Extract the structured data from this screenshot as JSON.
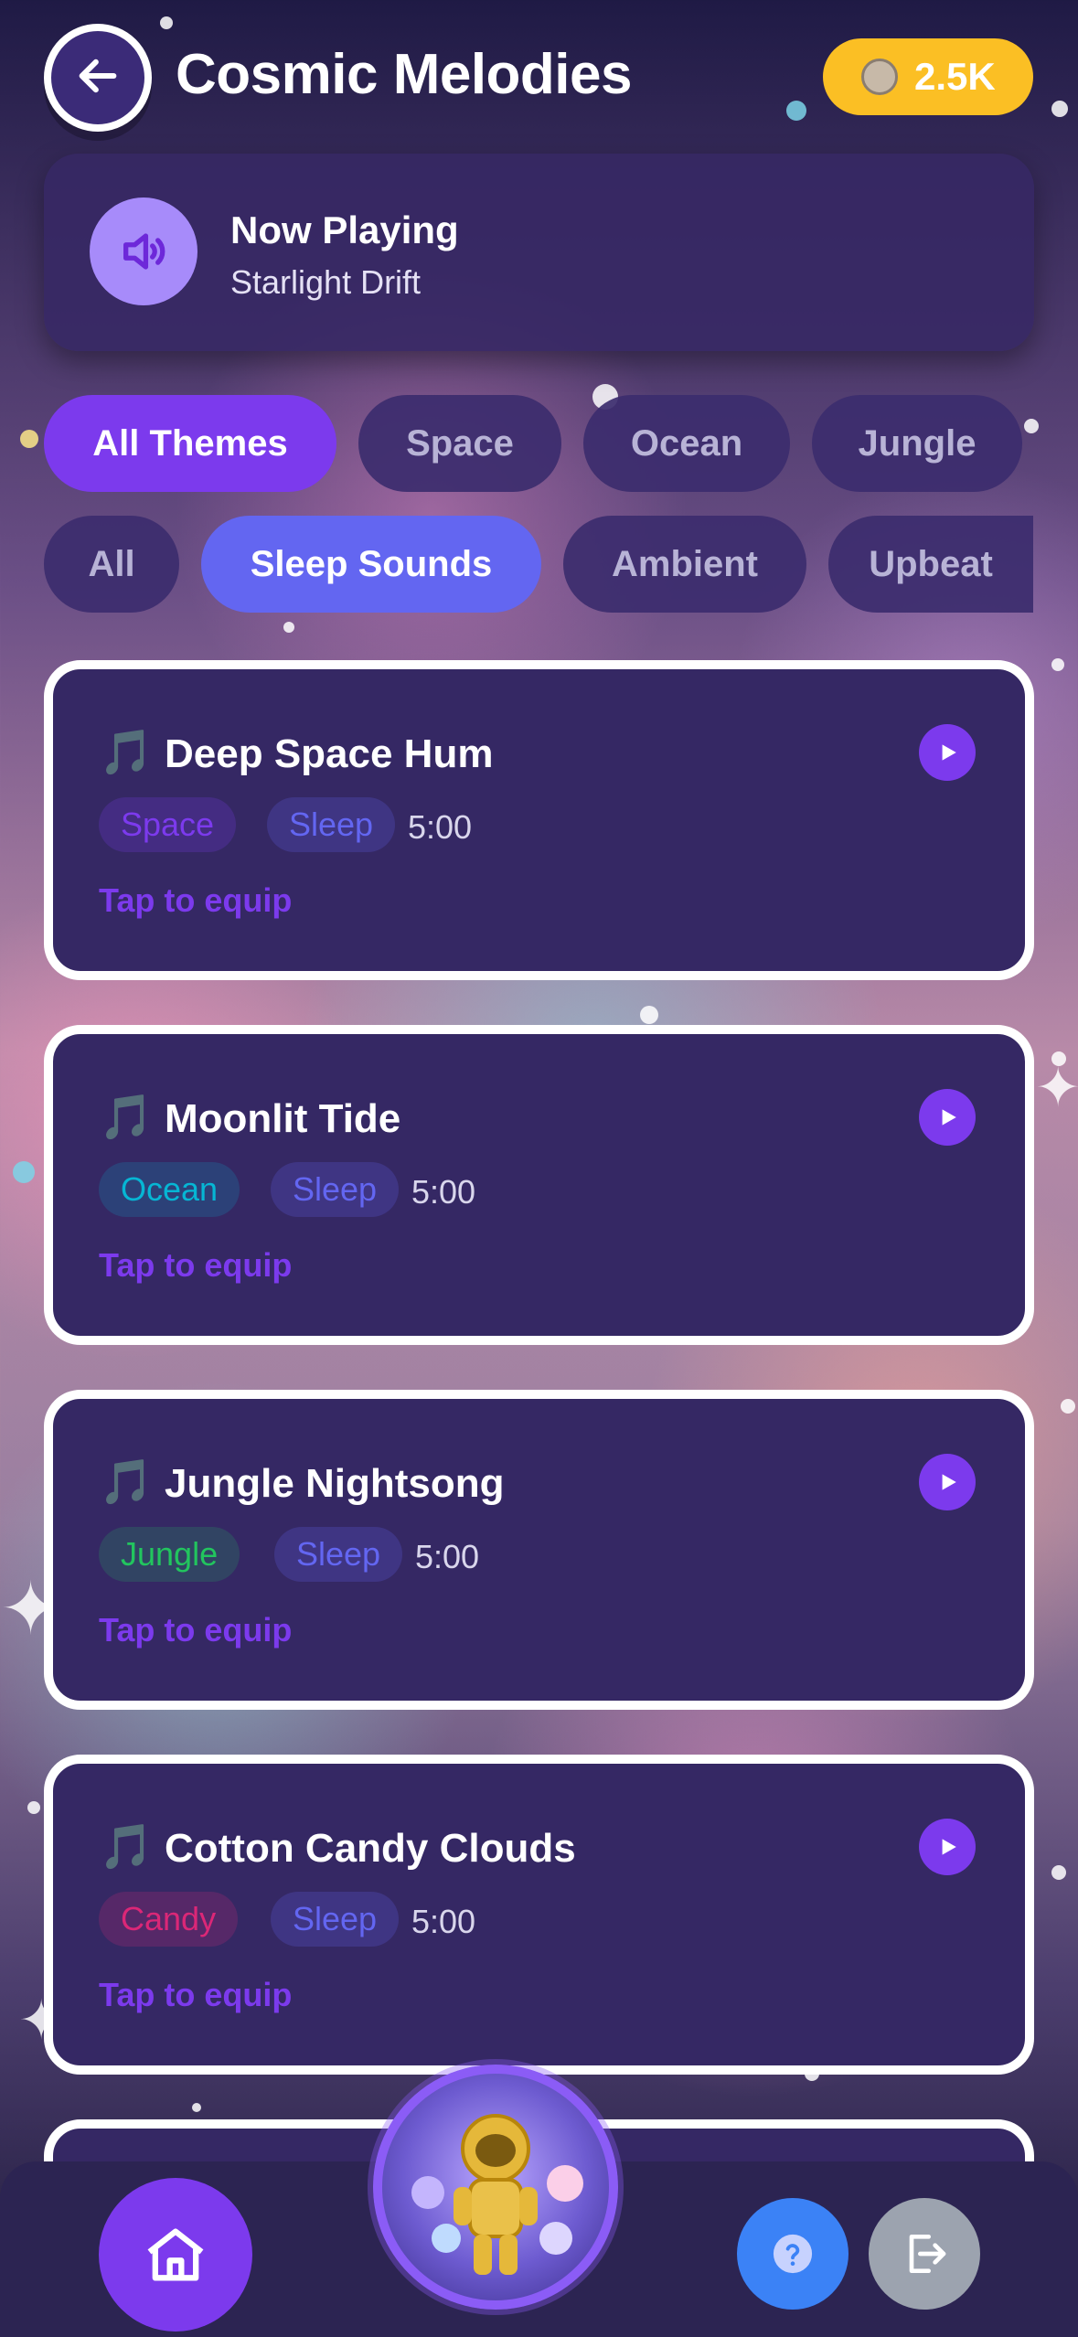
{
  "header": {
    "title": "Cosmic Melodies",
    "coins": "2.5K",
    "back_icon": "arrow-left-icon",
    "coin_icon": "astronaut-avatar-icon"
  },
  "now_playing": {
    "label": "Now Playing",
    "track": "Starlight Drift",
    "icon": "speaker-icon"
  },
  "theme_filters": [
    {
      "label": "All Themes",
      "active": true
    },
    {
      "label": "Space",
      "active": false
    },
    {
      "label": "Ocean",
      "active": false
    },
    {
      "label": "Jungle",
      "active": false
    }
  ],
  "category_filters": [
    {
      "label": "All",
      "active": false
    },
    {
      "label": "Sleep Sounds",
      "active": true
    },
    {
      "label": "Ambient",
      "active": false
    },
    {
      "label": "Upbeat",
      "active": false
    }
  ],
  "tracks": [
    {
      "title": "Deep Space Hum",
      "theme": "Space",
      "category": "Sleep",
      "duration": "5:00",
      "action": "Tap to equip"
    },
    {
      "title": "Moonlit Tide",
      "theme": "Ocean",
      "category": "Sleep",
      "duration": "5:00",
      "action": "Tap to equip"
    },
    {
      "title": "Jungle Nightsong",
      "theme": "Jungle",
      "category": "Sleep",
      "duration": "5:00",
      "action": "Tap to equip"
    },
    {
      "title": "Cotton Candy Clouds",
      "theme": "Candy",
      "category": "Sleep",
      "duration": "5:00",
      "action": "Tap to equip"
    }
  ],
  "colors": {
    "accent": "#7c3aed",
    "category_active": "#6366f1",
    "coin": "#fbbf24",
    "card_bg": "#352864",
    "tag_space_text": "#7c3aed",
    "tag_ocean_text": "#06b6d4",
    "tag_jungle_text": "#22c55e",
    "tag_candy_text": "#db2777",
    "tag_sleep_text": "#6366f1"
  },
  "nav": {
    "home_icon": "home-icon",
    "avatar_icon": "astronaut-avatar-icon",
    "help_icon": "question-icon",
    "logout_icon": "logout-icon"
  }
}
